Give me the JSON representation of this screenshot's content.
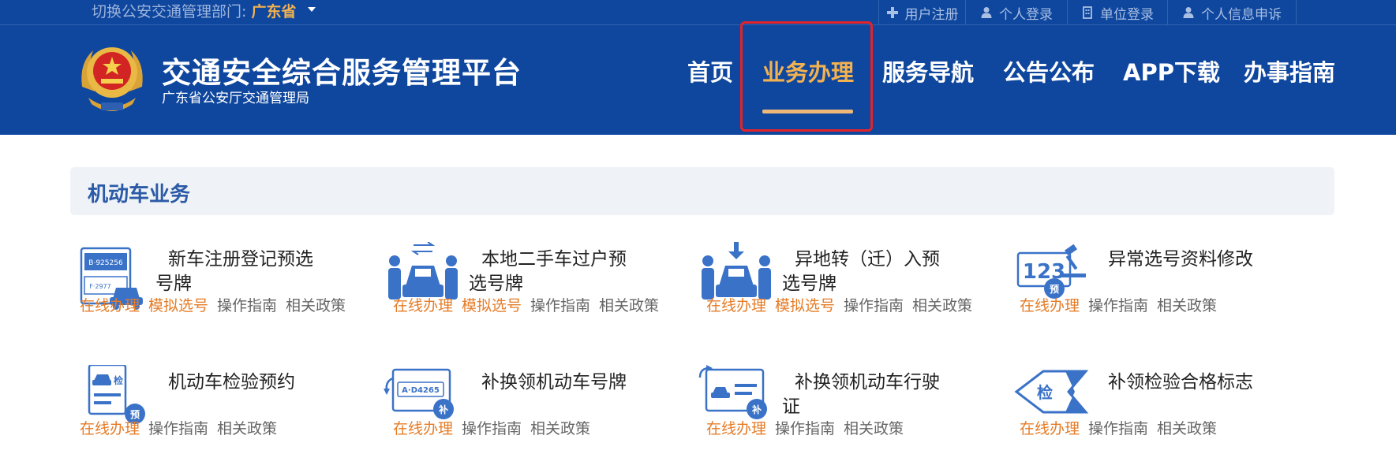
{
  "topbar": {
    "dept_label": "切换公安交通管理部门:",
    "dept_value": "广东省",
    "links": [
      {
        "label": "用户注册",
        "icon": "plus-icon"
      },
      {
        "label": "个人登录",
        "icon": "person-icon"
      },
      {
        "label": "单位登录",
        "icon": "building-icon"
      },
      {
        "label": "个人信息申诉",
        "icon": "person-icon"
      }
    ]
  },
  "brand": {
    "title": "交通安全综合服务管理平台",
    "subtitle": "广东省公安厅交通管理局",
    "logo_icon": "police-emblem-icon"
  },
  "nav": {
    "items": [
      "首页",
      "业务办理",
      "服务导航",
      "公告公布",
      "APP下载",
      "办事指南"
    ],
    "active": "业务办理"
  },
  "colors": {
    "header_bg": "#0f479e",
    "accent": "#f3b250",
    "link_orange": "#e57c27",
    "highlight_red": "#e3232a",
    "section_title": "#2b5aa6"
  },
  "section": {
    "title": "机动车业务"
  },
  "services": [
    {
      "name": "新车注册登记预选号牌",
      "icon": "license-plate-car-icon",
      "links": [
        "在线办理",
        "模拟选号",
        "操作指南",
        "相关政策"
      ]
    },
    {
      "name": "本地二手车过户预选号牌",
      "icon": "car-transfer-icon",
      "links": [
        "在线办理",
        "模拟选号",
        "操作指南",
        "相关政策"
      ]
    },
    {
      "name": "异地转（迁）入预选号牌",
      "icon": "car-relocate-icon",
      "links": [
        "在线办理",
        "模拟选号",
        "操作指南",
        "相关政策"
      ]
    },
    {
      "name": "异常选号资料修改",
      "icon": "number-plate-edit-icon",
      "links": [
        "在线办理",
        "操作指南",
        "相关政策"
      ]
    },
    {
      "name": "机动车检验预约",
      "icon": "inspection-appointment-icon",
      "links": [
        "在线办理",
        "操作指南",
        "相关政策"
      ]
    },
    {
      "name": "补换领机动车号牌",
      "icon": "plate-replace-icon",
      "links": [
        "在线办理",
        "操作指南",
        "相关政策"
      ]
    },
    {
      "name": "补换领机动车行驶证",
      "icon": "driving-license-replace-icon",
      "links": [
        "在线办理",
        "操作指南",
        "相关政策"
      ]
    },
    {
      "name": "补领检验合格标志",
      "icon": "inspection-mark-icon",
      "links": [
        "在线办理",
        "操作指南",
        "相关政策"
      ]
    }
  ]
}
